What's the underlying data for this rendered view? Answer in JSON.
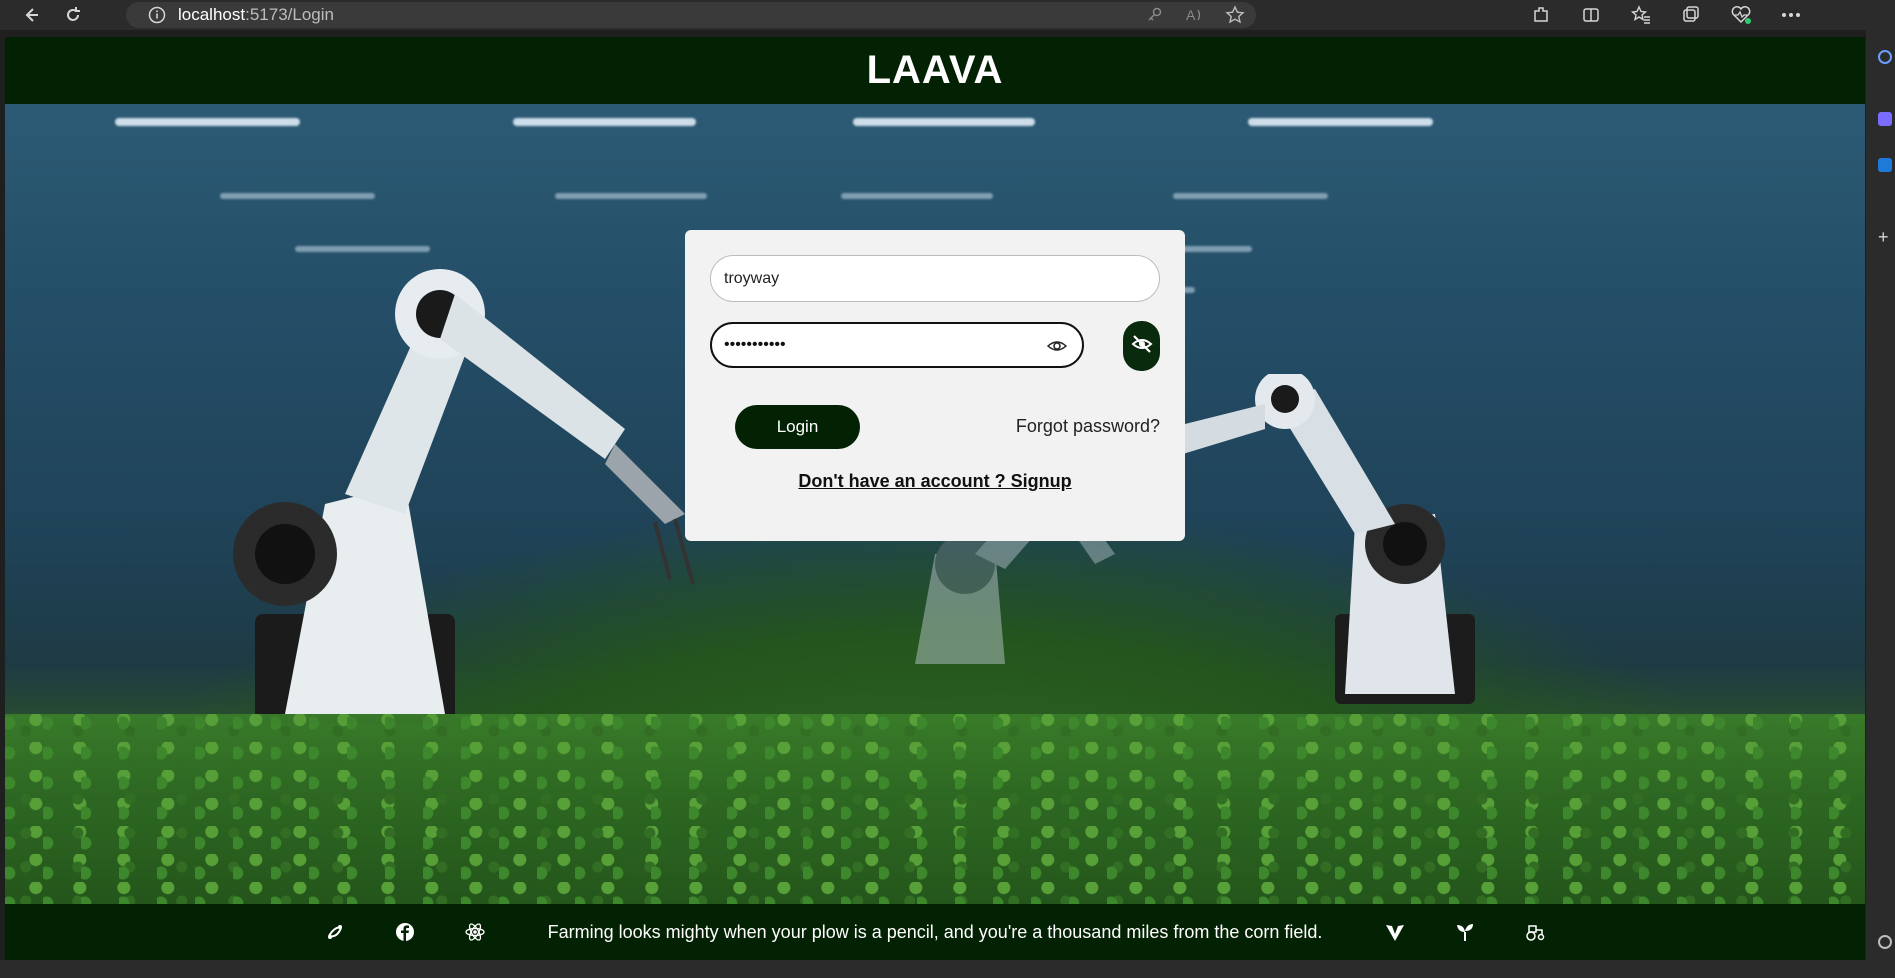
{
  "browser": {
    "url_host": "localhost",
    "url_path": ":5173/Login"
  },
  "header": {
    "title": "LAAVA"
  },
  "login_form": {
    "username_value": "troyway",
    "password_value": "•••••••••••",
    "login_label": "Login",
    "forgot_label": "Forgot password?",
    "signup_label": "Don't have an account ? Signup"
  },
  "footer": {
    "quote": "Farming looks mighty when your plow is a pencil, and you're a thousand miles from the corn field.",
    "left_icons": [
      "swirl-icon",
      "facebook-icon",
      "react-icon"
    ],
    "right_icons": [
      "vite-icon",
      "sprout-icon",
      "tractor-icon"
    ]
  },
  "colors": {
    "primary_dark_green": "#032103",
    "card_bg": "#f2f2f2"
  }
}
